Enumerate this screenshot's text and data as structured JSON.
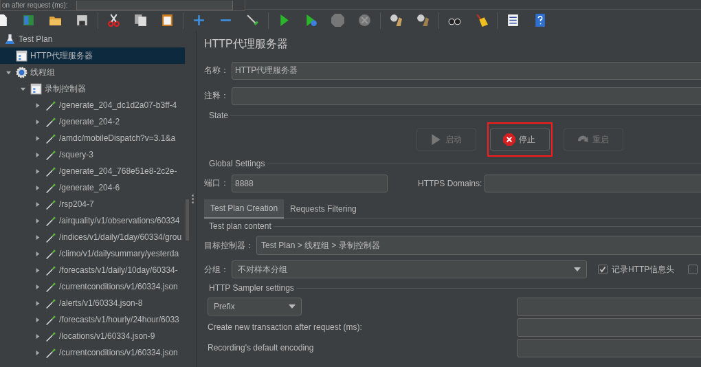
{
  "popup": {
    "text": "on after request (ms):"
  },
  "tree": [
    {
      "label": "Test Plan",
      "kind": "plan",
      "selected": false,
      "children": [
        {
          "label": "HTTP代理服务器",
          "kind": "proxy",
          "selected": true
        },
        {
          "label": "线程组",
          "kind": "threadgroup",
          "selected": false,
          "expanded": true,
          "children": [
            {
              "label": "录制控制器",
              "kind": "controller",
              "selected": false,
              "expanded": true,
              "children": [
                {
                  "label": "/generate_204_dc1d2a07-b3ff-4",
                  "kind": "sampler",
                  "selected": false,
                  "expanded": false
                },
                {
                  "label": "/generate_204-2",
                  "kind": "sampler",
                  "selected": false,
                  "expanded": false
                },
                {
                  "label": "/amdc/mobileDispatch?v=3.1&a",
                  "kind": "sampler",
                  "selected": false,
                  "expanded": false
                },
                {
                  "label": "/squery-3",
                  "kind": "sampler",
                  "selected": false,
                  "expanded": false
                },
                {
                  "label": "/generate_204_768e51e8-2c2e-",
                  "kind": "sampler",
                  "selected": false,
                  "expanded": false
                },
                {
                  "label": "/generate_204-6",
                  "kind": "sampler",
                  "selected": false,
                  "expanded": false
                },
                {
                  "label": "/rsp204-7",
                  "kind": "sampler",
                  "selected": false,
                  "expanded": false
                },
                {
                  "label": "/airquality/v1/observations/60334",
                  "kind": "sampler",
                  "selected": false,
                  "expanded": false
                },
                {
                  "label": "/indices/v1/daily/1day/60334/grou",
                  "kind": "sampler",
                  "selected": false,
                  "expanded": false
                },
                {
                  "label": "/climo/v1/dailysummary/yesterda",
                  "kind": "sampler",
                  "selected": false,
                  "expanded": false
                },
                {
                  "label": "/forecasts/v1/daily/10day/60334-",
                  "kind": "sampler",
                  "selected": false,
                  "expanded": false
                },
                {
                  "label": "/currentconditions/v1/60334.json",
                  "kind": "sampler",
                  "selected": false,
                  "expanded": false
                },
                {
                  "label": "/alerts/v1/60334.json-8",
                  "kind": "sampler",
                  "selected": false,
                  "expanded": false
                },
                {
                  "label": "/forecasts/v1/hourly/24hour/6033",
                  "kind": "sampler",
                  "selected": false,
                  "expanded": false
                },
                {
                  "label": "/locations/v1/60334.json-9",
                  "kind": "sampler",
                  "selected": false,
                  "expanded": false
                },
                {
                  "label": "/currentconditions/v1/60334.json",
                  "kind": "sampler",
                  "selected": false,
                  "expanded": false
                }
              ]
            }
          ]
        }
      ]
    }
  ],
  "panel": {
    "title": "HTTP代理服务器",
    "fields": [
      {
        "label": "名称：",
        "value": "HTTP代理服务器"
      },
      {
        "label": "注释："
      }
    ]
  },
  "state": {
    "legend": "State",
    "buttons": [
      {
        "label": "启动",
        "kind": "start",
        "disabled": true,
        "highlighted": false
      },
      {
        "label": "停止",
        "kind": "stop",
        "disabled": false,
        "highlighted": true
      },
      {
        "label": "重启",
        "kind": "restart",
        "disabled": true,
        "highlighted": false
      }
    ]
  },
  "global_settings": {
    "legend": "Global Settings",
    "port_label": "端口：",
    "port_value": "8888",
    "https_label": "HTTPS Domains:"
  },
  "tabs": [
    {
      "label": "Test Plan Creation",
      "selected": true
    },
    {
      "label": "Requests Filtering",
      "selected": false
    }
  ],
  "test_plan_content": {
    "legend": "Test plan content",
    "target_label": "目标控制器：",
    "target_value": "Test Plan > 线程组 > 录制控制器",
    "grouping_label": "分组：",
    "grouping_value": "不对样本分组",
    "checkboxes": [
      {
        "label": "记录HTTP信息头",
        "checked": true
      },
      {
        "checked": false
      }
    ]
  },
  "sampler_settings": {
    "legend": "HTTP Sampler settings",
    "naming_value": "Prefix",
    "transaction_label": "Create new transaction after request (ms):",
    "encoding_label": "Recording's default encoding"
  }
}
